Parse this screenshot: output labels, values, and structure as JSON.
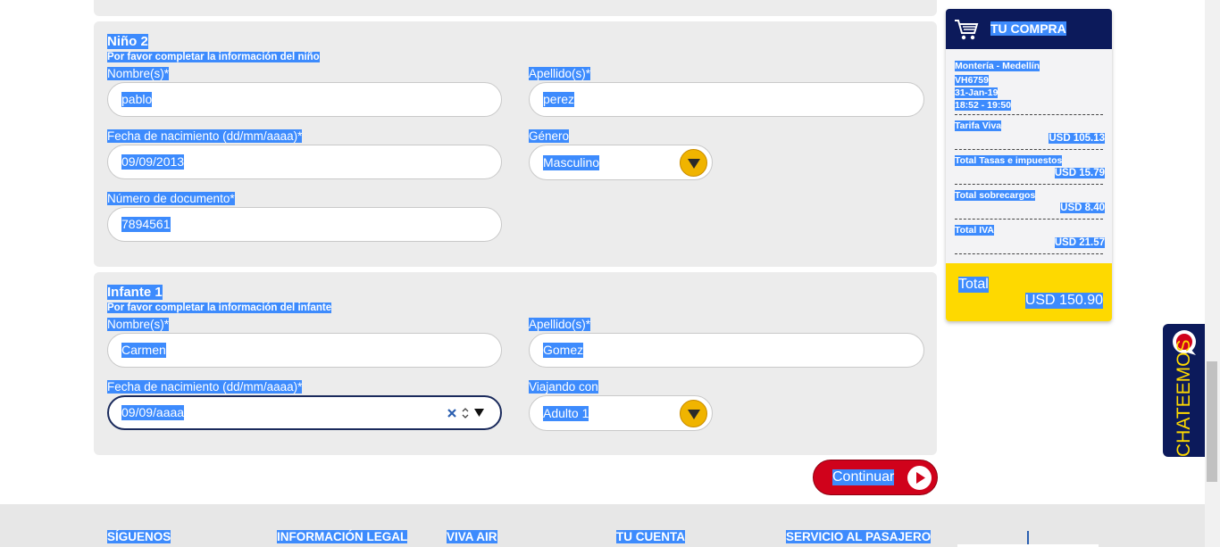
{
  "child": {
    "title": "Niño 2",
    "subtitle": "Por favor completar la información del niño",
    "name_label": "Nombre(s)*",
    "name_value": "pablo",
    "surname_label": "Apellido(s)*",
    "surname_value": "perez",
    "dob_label": "Fecha de nacimiento (dd/mm/aaaa)*",
    "dob_value": "09/09/2013",
    "gender_label": "Género",
    "gender_value": "Masculino",
    "doc_label": "Número de documento*",
    "doc_value": "7894561"
  },
  "infant": {
    "title": "Infante 1",
    "subtitle": "Por favor completar la información del infante",
    "name_label": "Nombre(s)*",
    "name_value": "Carmen",
    "surname_label": "Apellido(s)*",
    "surname_value": "Gomez",
    "dob_label": "Fecha de nacimiento (dd/mm/aaaa)*",
    "dob_value": "09/09/aaaa",
    "travel_label": "Viajando con",
    "travel_value": "Adulto 1"
  },
  "continue_label": "Continuar",
  "cart": {
    "title": "TU COMPRA",
    "route": "Montería - Medellín",
    "flight": "VH6759",
    "date": "31-Jan-19",
    "time": "18:52 - 19:50",
    "fare_label": "Tarifa Viva",
    "fare_value": "USD 105.13",
    "taxes_label": "Total Tasas e impuestos",
    "taxes_value": "USD 15.79",
    "surcharges_label": "Total sobrecargos",
    "surcharges_value": "USD 8.40",
    "iva_label": "Total IVA",
    "iva_value": "USD 21.57",
    "total_label": "Total",
    "total_value": "USD 150.90"
  },
  "chat_label": "CHATEEMOS",
  "footer": {
    "cols": [
      "SÍGUENOS",
      "INFORMACIÓN LEGAL",
      "VIVA AIR",
      "TU CUENTA",
      "SERVICIO AL PASAJERO"
    ]
  },
  "colors": {
    "navy": "#0c1a5b",
    "yellow": "#fed900",
    "red": "#d0021b",
    "selection": "#3d8bfd"
  }
}
